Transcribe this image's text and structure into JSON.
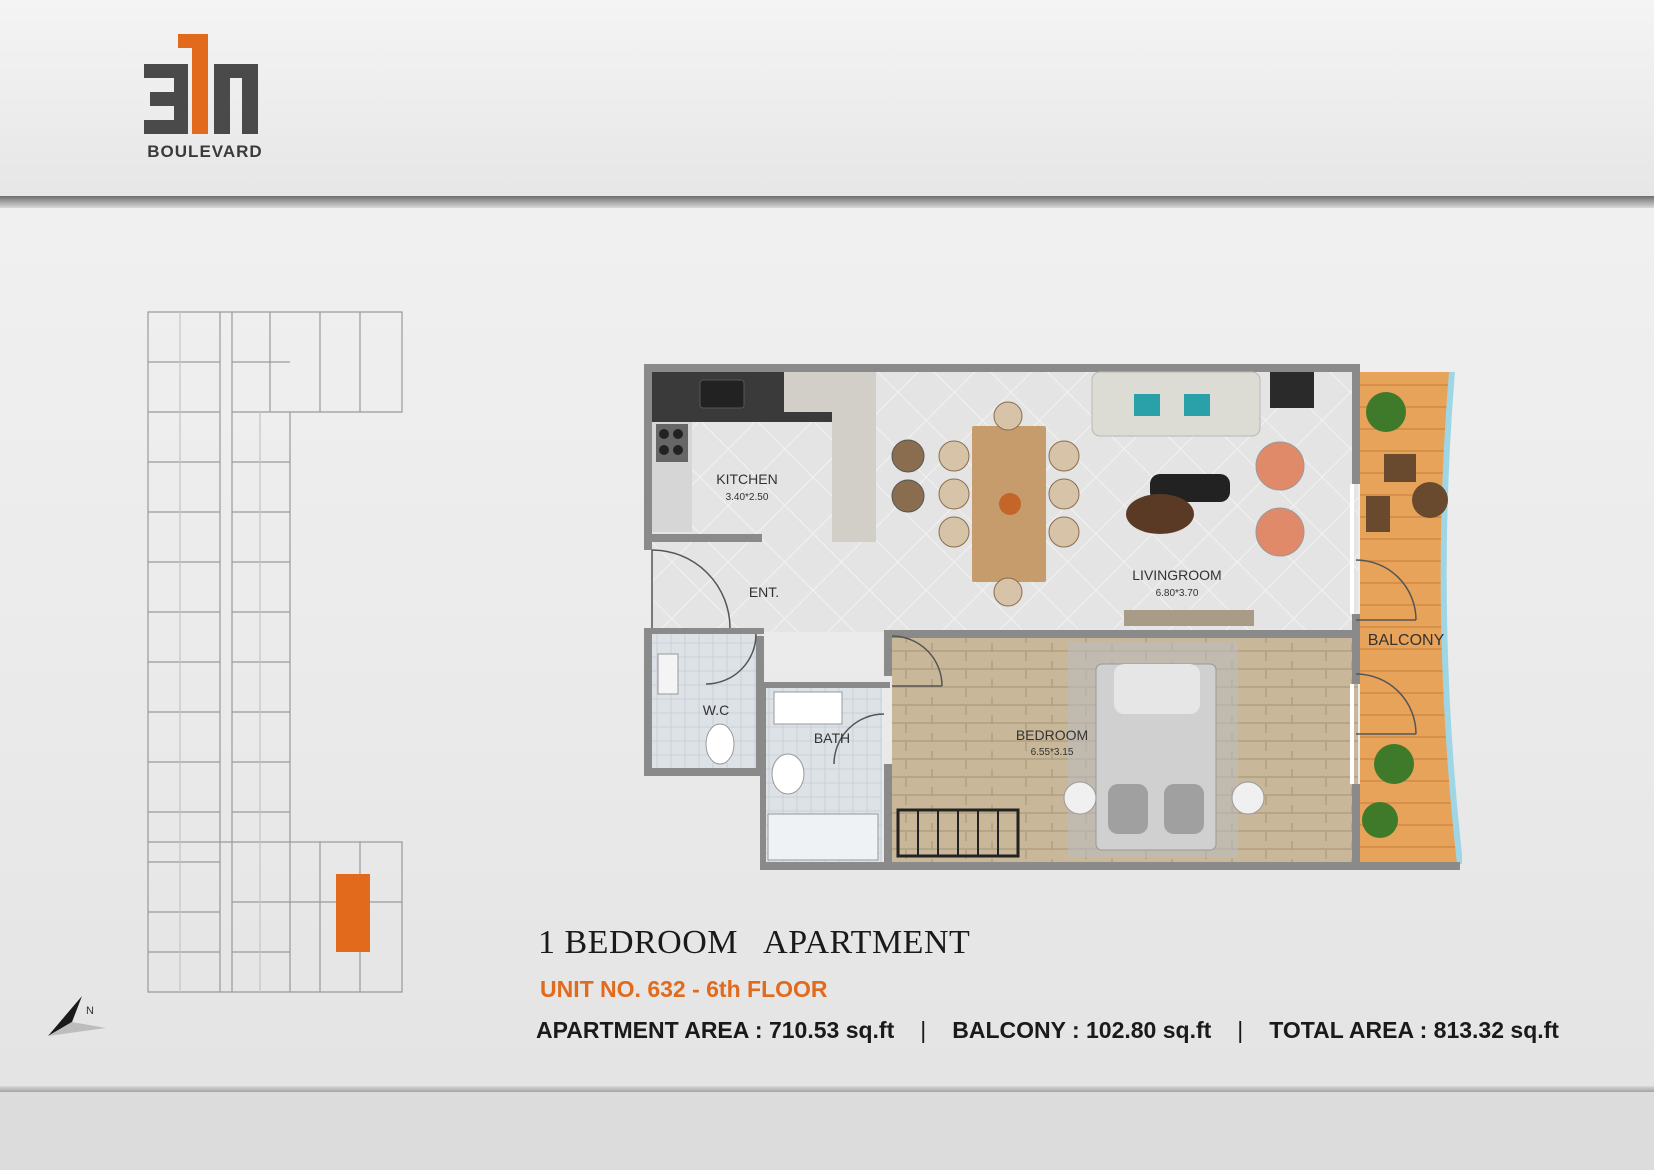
{
  "logo": {
    "numerals": "311",
    "word": "BOULEVARD"
  },
  "plan": {
    "rooms": {
      "kitchen": {
        "label": "KITCHEN",
        "dims": "3.40*2.50"
      },
      "entrance": {
        "label": "ENT."
      },
      "living": {
        "label": "LIVINGROOM",
        "dims": "6.80*3.70"
      },
      "wc": {
        "label": "W.C"
      },
      "bath": {
        "label": "BATH"
      },
      "bedroom": {
        "label": "BEDROOM",
        "dims": "6.55*3.15"
      },
      "balcony": {
        "label": "BALCONY"
      }
    }
  },
  "info": {
    "title": "1 BEDROOM   APARTMENT",
    "unit": "UNIT NO.  632 - 6th FLOOR",
    "apartment_area": "APARTMENT AREA : 710.53 sq.ft",
    "balcony_area": "BALCONY : 102.80 sq.ft",
    "total_area": "TOTAL AREA : 813.32 sq.ft",
    "separator": "|"
  },
  "colors": {
    "accent": "#e26a1c",
    "wall": "#8a8a8a",
    "floor_wood": "#c9b79a",
    "balcony": "#e8a35b"
  }
}
